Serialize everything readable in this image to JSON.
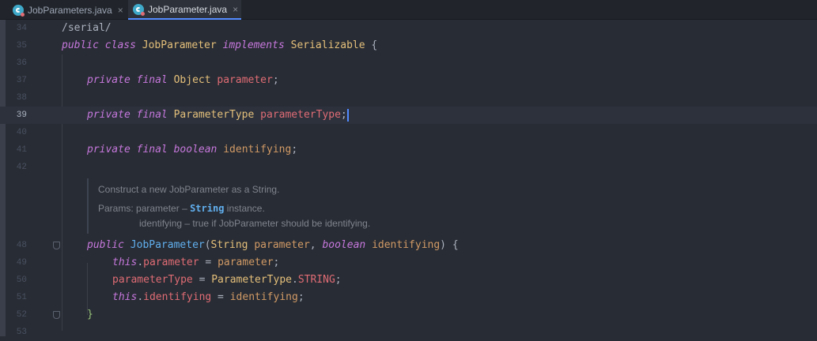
{
  "tabs": [
    {
      "label": "JobParameters.java",
      "close": "×",
      "icon": "java-class-icon",
      "active": false
    },
    {
      "label": "JobParameter.java",
      "close": "×",
      "icon": "java-class-icon",
      "active": true
    }
  ],
  "editor": {
    "current_line": "39",
    "lines": {
      "l34": {
        "num": "34",
        "text": "/serial/"
      },
      "l35": {
        "num": "35",
        "kw1": "public",
        "kw2": "class",
        "name": "JobParameter",
        "kw3": "implements",
        "iface": "Serializable",
        "brace": "{"
      },
      "l36": {
        "num": "36"
      },
      "l37": {
        "num": "37",
        "kw1": "private",
        "kw2": "final",
        "type": "Object",
        "field": "parameter",
        "semi": ";"
      },
      "l38": {
        "num": "38"
      },
      "l39": {
        "num": "39",
        "kw1": "private",
        "kw2": "final",
        "type": "ParameterType",
        "field": "parameterType",
        "semi": ";"
      },
      "l40": {
        "num": "40"
      },
      "l41": {
        "num": "41",
        "kw1": "private",
        "kw2": "final",
        "type": "boolean",
        "field": "identifying",
        "semi": ";"
      },
      "l42": {
        "num": "42"
      },
      "l48": {
        "num": "48",
        "kw1": "public",
        "name": "JobParameter",
        "open": "(",
        "t1": "String",
        "p1": "parameter",
        "comma": ",",
        "t2": "boolean",
        "p2": "identifying",
        "close": ")",
        "brace": "{"
      },
      "l49": {
        "num": "49",
        "kw": "this",
        "dot": ".",
        "field": "parameter",
        "eq": " = ",
        "val": "parameter",
        "semi": ";"
      },
      "l50": {
        "num": "50",
        "field": "parameterType",
        "eq": " = ",
        "type": "ParameterType",
        "dot": ".",
        "const": "STRING",
        "semi": ";"
      },
      "l51": {
        "num": "51",
        "kw": "this",
        "dot": ".",
        "field": "identifying",
        "eq": " = ",
        "val": "identifying",
        "semi": ";"
      },
      "l52": {
        "num": "52",
        "brace": "}"
      },
      "l53": {
        "num": "53"
      }
    }
  },
  "doc": {
    "summary": "Construct a new JobParameter as a String.",
    "params_label": "Params:",
    "param1_name": "parameter",
    "dash": " – ",
    "param1_code": "String",
    "param1_rest": " instance.",
    "param2_name": "identifying",
    "param2_desc": " – true if JobParameter should be identifying."
  },
  "colors": {
    "keyword": "#c678dd",
    "type": "#e5c07b",
    "field": "#e06c75",
    "param": "#d19a66",
    "method": "#61afef",
    "caret": "#528bff"
  }
}
